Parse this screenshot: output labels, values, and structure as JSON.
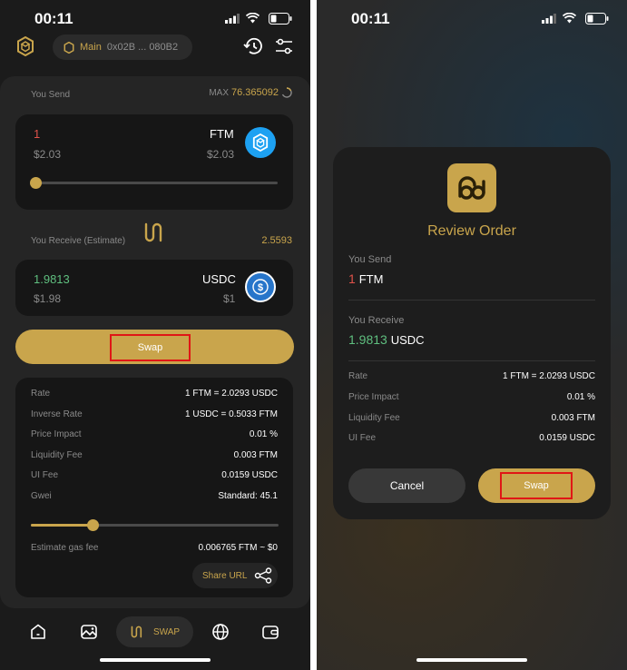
{
  "status": {
    "time": "00:11"
  },
  "header": {
    "wallet_name": "Main",
    "wallet_address": "0x02B ... 080B2"
  },
  "send": {
    "label": "You Send",
    "max_label": "MAX",
    "max_value": "76.365092",
    "amount": "1",
    "token": "FTM",
    "usd_left": "$2.03",
    "usd_right": "$2.03",
    "slider_fraction": 0.0
  },
  "receive": {
    "label": "You Receive (Estimate)",
    "estimate": "2.5593",
    "amount": "1.9813",
    "token": "USDC",
    "usd_left": "$1.98",
    "usd_right": "$1"
  },
  "swap_button": "Swap",
  "details": [
    {
      "k": "Rate",
      "v": "1 FTM = 2.0293 USDC"
    },
    {
      "k": "Inverse Rate",
      "v": "1 USDC = 0.5033 FTM"
    },
    {
      "k": "Price Impact",
      "v": "0.01 %"
    },
    {
      "k": "Liquidity Fee",
      "v": "0.003 FTM"
    },
    {
      "k": "UI Fee",
      "v": "0.0159 USDC"
    },
    {
      "k": "Gwei",
      "v": "Standard: 45.1"
    }
  ],
  "gas": {
    "label": "Estimate gas fee",
    "value": "0.006765 FTM ~ $0",
    "slider_fraction": 0.25
  },
  "share_label": "Share URL",
  "nav": {
    "swap_label": "SWAP"
  },
  "review": {
    "title": "Review Order",
    "send_label": "You Send",
    "send_amount": "1",
    "send_token": "FTM",
    "recv_label": "You Receive",
    "recv_amount": "1.9813",
    "recv_token": "USDC",
    "rows": [
      {
        "k": "Rate",
        "v": "1 FTM = 2.0293 USDC"
      },
      {
        "k": "Price Impact",
        "v": "0.01 %"
      },
      {
        "k": "Liquidity Fee",
        "v": "0.003 FTM"
      },
      {
        "k": "UI Fee",
        "v": "0.0159 USDC"
      }
    ],
    "cancel_label": "Cancel",
    "confirm_label": "Swap"
  },
  "colors": {
    "accent": "#c9a54c",
    "send_amount": "#e0524a",
    "recv_amount": "#5fbf7f",
    "highlight": "#e01616",
    "ftm": "#1da1f2",
    "usdc": "#2775ca"
  }
}
